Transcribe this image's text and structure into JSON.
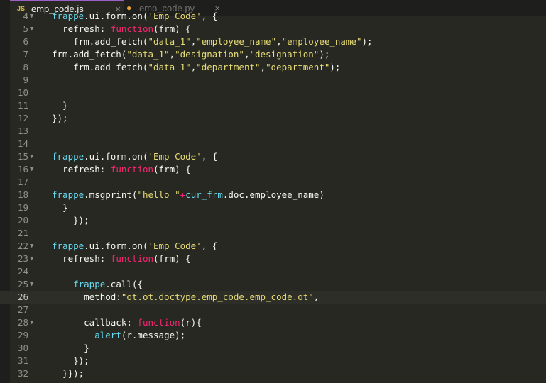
{
  "tabs": [
    {
      "badge": "JS",
      "name": "emp_code.js",
      "close": "×",
      "active": true
    },
    {
      "badge": "py-icon",
      "name": "emp_code.py",
      "close": "×",
      "active": false
    }
  ],
  "lines": [
    {
      "n": "4",
      "fold": "▼",
      "tokens": [
        {
          "c": "f",
          "t": "frappe"
        },
        {
          "t": ".ui.form.on("
        },
        {
          "c": "s",
          "t": "'Emp Code'"
        },
        {
          "t": ", {"
        }
      ]
    },
    {
      "n": "5",
      "fold": "▼",
      "tokens": [
        {
          "t": "  refresh: "
        },
        {
          "c": "k",
          "t": "function"
        },
        {
          "t": "(frm) {"
        }
      ]
    },
    {
      "n": "6",
      "fold": "",
      "tokens": [
        {
          "t": "    frm.add_fetch("
        },
        {
          "c": "s",
          "t": "\"data_1\""
        },
        {
          "t": ","
        },
        {
          "c": "s",
          "t": "\"employee_name\""
        },
        {
          "t": ","
        },
        {
          "c": "s",
          "t": "\"employee_name\""
        },
        {
          "t": ");"
        }
      ]
    },
    {
      "n": "7",
      "fold": "",
      "tokens": [
        {
          "t": "frm.add_fetch("
        },
        {
          "c": "s",
          "t": "\"data_1\""
        },
        {
          "t": ","
        },
        {
          "c": "s",
          "t": "\"designation\""
        },
        {
          "t": ","
        },
        {
          "c": "s",
          "t": "\"designation\""
        },
        {
          "t": ");"
        }
      ]
    },
    {
      "n": "8",
      "fold": "",
      "tokens": [
        {
          "t": "    frm.add_fetch("
        },
        {
          "c": "s",
          "t": "\"data_1\""
        },
        {
          "t": ","
        },
        {
          "c": "s",
          "t": "\"department\""
        },
        {
          "t": ","
        },
        {
          "c": "s",
          "t": "\"department\""
        },
        {
          "t": ");"
        }
      ]
    },
    {
      "n": "9",
      "fold": "",
      "tokens": []
    },
    {
      "n": "10",
      "fold": "",
      "tokens": []
    },
    {
      "n": "11",
      "fold": "",
      "tokens": [
        {
          "t": "  }"
        }
      ]
    },
    {
      "n": "12",
      "fold": "",
      "tokens": [
        {
          "t": "});"
        }
      ]
    },
    {
      "n": "13",
      "fold": "",
      "tokens": []
    },
    {
      "n": "14",
      "fold": "",
      "tokens": []
    },
    {
      "n": "15",
      "fold": "▼",
      "tokens": [
        {
          "c": "f",
          "t": "frappe"
        },
        {
          "t": ".ui.form.on("
        },
        {
          "c": "s",
          "t": "'Emp Code'"
        },
        {
          "t": ", {"
        }
      ]
    },
    {
      "n": "16",
      "fold": "▼",
      "tokens": [
        {
          "t": "  refresh: "
        },
        {
          "c": "k",
          "t": "function"
        },
        {
          "t": "(frm) {"
        }
      ]
    },
    {
      "n": "17",
      "fold": "",
      "tokens": []
    },
    {
      "n": "18",
      "fold": "",
      "tokens": [
        {
          "c": "f",
          "t": "frappe"
        },
        {
          "t": ".msgprint("
        },
        {
          "c": "s",
          "t": "\"hello \""
        },
        {
          "c": "k",
          "t": "+"
        },
        {
          "c": "f",
          "t": "cur_frm"
        },
        {
          "t": ".doc.employee_name)"
        }
      ]
    },
    {
      "n": "19",
      "fold": "",
      "tokens": [
        {
          "t": "  }"
        }
      ]
    },
    {
      "n": "20",
      "fold": "",
      "tokens": [
        {
          "t": "    });"
        }
      ]
    },
    {
      "n": "21",
      "fold": "",
      "tokens": []
    },
    {
      "n": "22",
      "fold": "▼",
      "tokens": [
        {
          "c": "f",
          "t": "frappe"
        },
        {
          "t": ".ui.form.on("
        },
        {
          "c": "s",
          "t": "'Emp Code'"
        },
        {
          "t": ", {"
        }
      ]
    },
    {
      "n": "23",
      "fold": "▼",
      "tokens": [
        {
          "t": "  refresh: "
        },
        {
          "c": "k",
          "t": "function"
        },
        {
          "t": "(frm) {"
        }
      ]
    },
    {
      "n": "24",
      "fold": "",
      "tokens": []
    },
    {
      "n": "25",
      "fold": "▼",
      "tokens": [
        {
          "t": "    "
        },
        {
          "c": "f",
          "t": "frappe"
        },
        {
          "t": ".call({"
        }
      ]
    },
    {
      "n": "26",
      "fold": "",
      "active": true,
      "tokens": [
        {
          "t": "      method:"
        },
        {
          "c": "s",
          "t": "\"ot.ot.doctype.emp_code.emp_code.ot\""
        },
        {
          "t": ","
        }
      ]
    },
    {
      "n": "27",
      "fold": "",
      "tokens": []
    },
    {
      "n": "28",
      "fold": "▼",
      "tokens": [
        {
          "t": "      callback: "
        },
        {
          "c": "k",
          "t": "function"
        },
        {
          "t": "(r){"
        }
      ]
    },
    {
      "n": "29",
      "fold": "",
      "tokens": [
        {
          "t": "        "
        },
        {
          "c": "f",
          "t": "alert"
        },
        {
          "t": "(r.message);"
        }
      ]
    },
    {
      "n": "30",
      "fold": "",
      "tokens": [
        {
          "t": "      }"
        }
      ]
    },
    {
      "n": "31",
      "fold": "",
      "tokens": [
        {
          "t": "    });"
        }
      ]
    },
    {
      "n": "32",
      "fold": "",
      "tokens": [
        {
          "t": "  }});"
        }
      ]
    }
  ]
}
